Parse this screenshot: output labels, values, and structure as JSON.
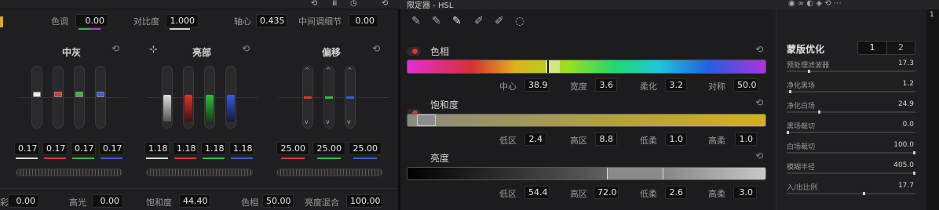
{
  "top": {
    "hue_label": "色调",
    "hue_value": "0.00",
    "contrast_label": "对比度",
    "contrast_value": "1.000",
    "pivot_label": "轴心",
    "pivot_value": "0.435",
    "mid_detail_label": "中间调细节",
    "mid_detail_value": "0.00"
  },
  "wheels": [
    {
      "title": "中灰",
      "values": [
        "0.17",
        "0.17",
        "0.17",
        "0.17"
      ]
    },
    {
      "title": "亮部",
      "values": [
        "1.18",
        "1.18",
        "1.18",
        "1.18"
      ]
    },
    {
      "title": "偏移",
      "values": [
        "25.00",
        "25.00",
        "25.00"
      ]
    }
  ],
  "bottom": {
    "shadow_label": "彩",
    "shadow_value": "0.00",
    "highlight_label": "高光",
    "highlight_value": "0.00",
    "saturation_label": "饱和度",
    "saturation_value": "44.40",
    "hue_label": "色相",
    "hue_value": "50.00",
    "lum_mix_label": "亮度混合",
    "lum_mix_value": "100.00"
  },
  "qualifier": {
    "title": "限定器 - HSL",
    "hue": {
      "label": "色相",
      "fields": [
        {
          "label": "中心",
          "value": "38.9"
        },
        {
          "label": "宽度",
          "value": "3.6"
        },
        {
          "label": "柔化",
          "value": "3.2"
        },
        {
          "label": "对称",
          "value": "50.0"
        }
      ]
    },
    "saturation": {
      "label": "饱和度",
      "fields": [
        {
          "label": "低区",
          "value": "2.4"
        },
        {
          "label": "高区",
          "value": "8.8"
        },
        {
          "label": "低柔",
          "value": "1.0"
        },
        {
          "label": "高柔",
          "value": "1.0"
        }
      ]
    },
    "luminance": {
      "label": "亮度",
      "fields": [
        {
          "label": "低区",
          "value": "54.4"
        },
        {
          "label": "高区",
          "value": "72.0"
        },
        {
          "label": "低柔",
          "value": "2.6"
        },
        {
          "label": "高柔",
          "value": "3.0"
        }
      ]
    }
  },
  "mask": {
    "title": "蒙版优化",
    "tab1": "1",
    "tab2": "2",
    "rows": [
      {
        "label": "预处理滤波器",
        "value": "17.3",
        "level": 0.17
      },
      {
        "label": "净化黑场",
        "value": "1.2",
        "level": 0.02
      },
      {
        "label": "净化白场",
        "value": "24.9",
        "level": 0.25
      },
      {
        "label": "黑场裁切",
        "value": "0.0",
        "level": 0.0
      },
      {
        "label": "白场裁切",
        "value": "100.0",
        "level": 1.0
      },
      {
        "label": "模糊半径",
        "value": "405.0",
        "level": 1.0
      },
      {
        "label": "入/出比例",
        "value": "17.7",
        "level": 0.6
      }
    ]
  },
  "far_right": {
    "value": "1"
  },
  "colors": {
    "red": "#e0342c",
    "green": "#2fbf3a",
    "blue": "#3a5bd8",
    "white": "#dddddd",
    "sat_bar": "#c9a21a"
  }
}
